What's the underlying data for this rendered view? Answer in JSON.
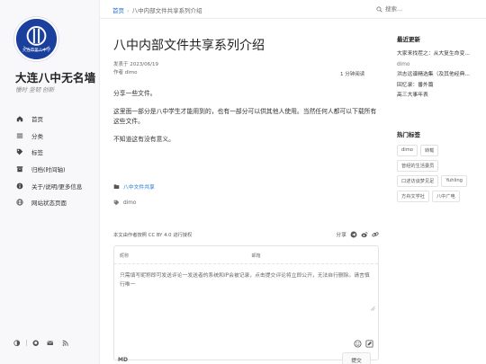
{
  "site": {
    "title": "大连八中无名墙",
    "motto": "慢时 坚韧 创新",
    "logo_text": "大连市第八中学"
  },
  "nav": [
    {
      "label": "首页",
      "icon": "home-icon"
    },
    {
      "label": "分类",
      "icon": "list-icon"
    },
    {
      "label": "标签",
      "icon": "tag-icon"
    },
    {
      "label": "归档(时间轴)",
      "icon": "archive-icon"
    },
    {
      "label": "关于/说明/更多信息",
      "icon": "info-icon"
    },
    {
      "label": "网站状态页面",
      "icon": "globe-icon"
    }
  ],
  "footer_icons": [
    "theme-toggle-icon",
    "github-icon",
    "mail-icon",
    "rss-icon"
  ],
  "breadcrumb": {
    "home": "首页",
    "sep": "›",
    "current": "八中内部文件共享系列介绍"
  },
  "search": {
    "placeholder": "搜索..."
  },
  "post": {
    "title": "八中内部文件共享系列介绍",
    "published": "发表于 2023/06/19",
    "author": "作者 dimo",
    "read_time": "1 分钟阅读",
    "paragraphs": [
      "分享一些文件。",
      "这里面一部分是八中学生才能用到的，也有一部分可以供其他人使用。当然任何人都可以下载所有这些文件。",
      "不知道这有没有意义。"
    ],
    "category": "八中文件共享",
    "tag": "dimo",
    "license": "本文由作者按照 CC BY 4.0 进行授权",
    "share_label": "分享"
  },
  "comment": {
    "nick_label": "昵称",
    "email_label": "邮箱",
    "placeholder": "只需填写昵称即可发送评论一发送者的系统和IP会被记录，点击提交评论将立即公开，无法自行删除。请言慎行唯一",
    "markdown_badge": "MD",
    "submit_label": "提交"
  },
  "aside": {
    "recent_title": "最近更新",
    "recent": [
      {
        "text": "大家来找茬之：从大复生命变...",
        "muted": false
      },
      {
        "text": "dimo",
        "muted": true
      },
      {
        "text": "洪志远谱精选集（及其他经典...",
        "muted": false
      },
      {
        "text": "回忆录：番外篇",
        "muted": false
      },
      {
        "text": "高三大事年表",
        "muted": false
      }
    ],
    "tags_title": "热门标签",
    "tags": [
      "dimo",
      "转载",
      "曾经的生活委员",
      "口述访谈梦见足",
      "Yuhling",
      "方舟文学社",
      "八中广电"
    ]
  },
  "colors": {
    "accent": "#1e6fd9",
    "logo_blue": "#1b3f9c",
    "sidebar_bg": "#f8f8fa"
  }
}
